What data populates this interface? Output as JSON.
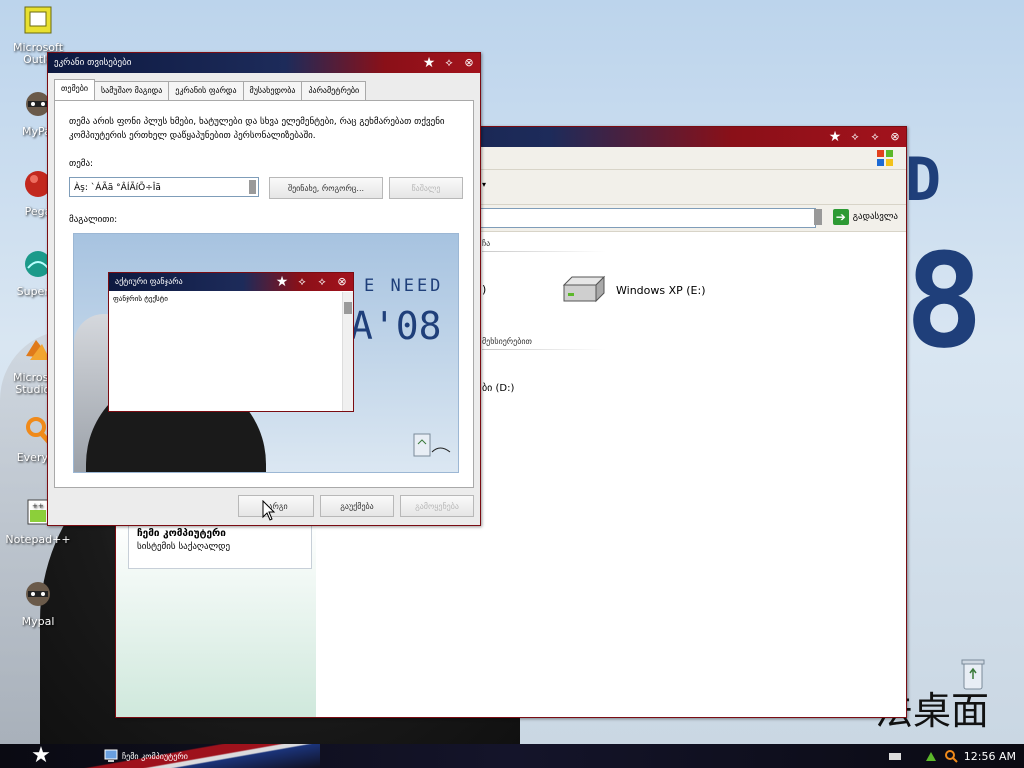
{
  "desktop": {
    "icons": [
      {
        "label": "Microsoft Outlo"
      },
      {
        "label": "MyPal"
      },
      {
        "label": "Pega"
      },
      {
        "label": "Superm"
      },
      {
        "label": "Microsoft Studio 2"
      },
      {
        "label": "Everyth"
      },
      {
        "label": "Notepad++"
      },
      {
        "label": "Mypal"
      }
    ],
    "bg_line1": "D",
    "bg_line2": "8",
    "brand": "法桌面"
  },
  "explorer": {
    "go_label": "გადასვლა",
    "group1_header": "ჩა",
    "drive_label": "Windows XP (E:)",
    "partial_drive_left": ")",
    "group2_header": "მეხსიერებით",
    "partial_drive_d": "ბი (D:)",
    "details_title": "ჩემი კომპიუტერი",
    "details_sub": "სისტემის საქაღალდე"
  },
  "theme_dialog": {
    "title": "ეკრანი თვისებები",
    "tabs": [
      "თემები",
      "სამუშაო მაგიდა",
      "ეკრანის ფარდა",
      "მუსახედობა",
      "პარამეტრები"
    ],
    "description": "თემა არის ფონი პლუს ხმები, ხატულები და სხვა ელემენტები, რაც გეხმარებათ თქვენი კომპიუტერის ერთხელ დაწყაპუნებით პერსონალიზებაში.",
    "theme_label": "თემა:",
    "theme_value": "Àş: `ÁÃã °ÂÍÃíÕ÷Îã",
    "save_as_label": "შეინახე, როგორც...",
    "delete_label": "წაშალე",
    "sample_label": "მაგალითი:",
    "preview": {
      "window_title": "აქტიური ფანჯარა",
      "window_text": "ფანჯრის ტექსტი",
      "text_line1": "E NEED",
      "text_line2": "A'08"
    },
    "ok_label": "კარგი",
    "cancel_label": "გაუქმება",
    "apply_label": "გამოყენება"
  },
  "taskbar": {
    "task_label": "ჩემი კომპიუტერი",
    "clock": "12:56 AM"
  },
  "colors": {
    "title_dark": "#0d1940",
    "title_red": "#a3121c",
    "bg_text": "#1f3f7a"
  }
}
